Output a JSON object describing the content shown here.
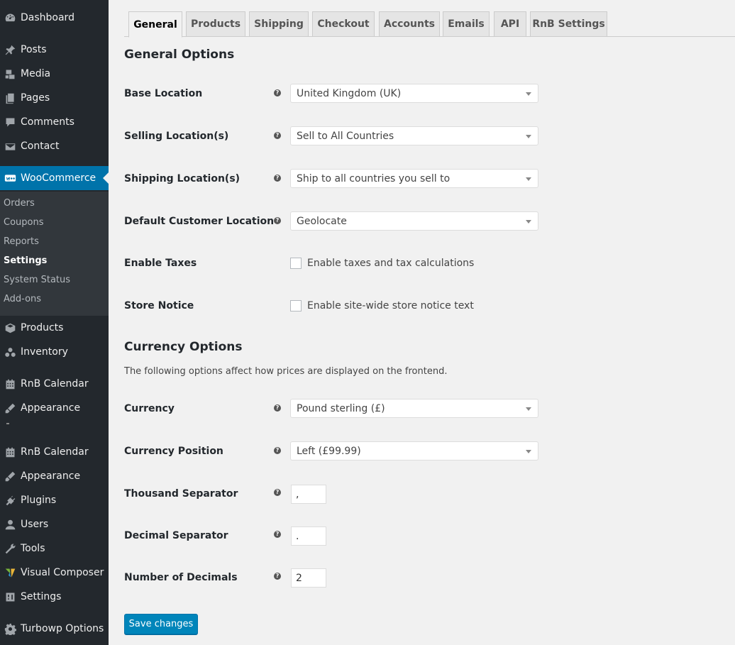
{
  "sidebar": {
    "menu": [
      {
        "label": "Dashboard",
        "icon": "dashboard-icon"
      },
      {
        "label": "Posts",
        "icon": "pin-icon"
      },
      {
        "label": "Media",
        "icon": "media-icon"
      },
      {
        "label": "Pages",
        "icon": "pages-icon"
      },
      {
        "label": "Comments",
        "icon": "comment-icon"
      },
      {
        "label": "Contact",
        "icon": "mail-icon"
      },
      {
        "label": "WooCommerce",
        "icon": "woo-icon"
      },
      {
        "label": "Products",
        "icon": "box-icon"
      },
      {
        "label": "Inventory",
        "icon": "inventory-icon"
      },
      {
        "label": "RnB Calendar",
        "icon": "calendar-icon"
      },
      {
        "label": "Appearance",
        "icon": "brush-icon"
      },
      {
        "label": "RnB Calendar",
        "icon": "calendar-icon"
      },
      {
        "label": "Appearance",
        "icon": "brush-icon"
      },
      {
        "label": "Plugins",
        "icon": "plug-icon"
      },
      {
        "label": "Users",
        "icon": "user-icon"
      },
      {
        "label": "Tools",
        "icon": "wrench-icon"
      },
      {
        "label": "Visual Composer",
        "icon": "vc-icon"
      },
      {
        "label": "Settings",
        "icon": "settings-icon"
      },
      {
        "label": "Turbowp Options",
        "icon": "gear-icon"
      }
    ],
    "submenu": [
      "Orders",
      "Coupons",
      "Reports",
      "Settings",
      "System Status",
      "Add-ons"
    ],
    "submenu_current": "Settings"
  },
  "tabs": [
    "General",
    "Products",
    "Shipping",
    "Checkout",
    "Accounts",
    "Emails",
    "API",
    "RnB Settings"
  ],
  "active_tab": "General",
  "general": {
    "title": "General Options",
    "base_location": {
      "label": "Base Location",
      "value": "United Kingdom (UK)"
    },
    "selling_locations": {
      "label": "Selling Location(s)",
      "value": "Sell to All Countries"
    },
    "shipping_locations": {
      "label": "Shipping Location(s)",
      "value": "Ship to all countries you sell to"
    },
    "default_customer_location": {
      "label": "Default Customer Location",
      "value": "Geolocate"
    },
    "enable_taxes": {
      "label": "Enable Taxes",
      "checkbox_label": "Enable taxes and tax calculations",
      "checked": false
    },
    "store_notice": {
      "label": "Store Notice",
      "checkbox_label": "Enable site-wide store notice text",
      "checked": false
    }
  },
  "currency": {
    "title": "Currency Options",
    "description": "The following options affect how prices are displayed on the frontend.",
    "currency": {
      "label": "Currency",
      "value": "Pound sterling (£)"
    },
    "currency_position": {
      "label": "Currency Position",
      "value": "Left (£99.99)"
    },
    "thousand_separator": {
      "label": "Thousand Separator",
      "value": ","
    },
    "decimal_separator": {
      "label": "Decimal Separator",
      "value": "."
    },
    "number_of_decimals": {
      "label": "Number of Decimals",
      "value": "2"
    }
  },
  "help_icon_glyph": "?",
  "save_label": "Save changes",
  "colors": {
    "sidebar_bg": "#23282d",
    "submenu_bg": "#32373c",
    "accent": "#0073aa",
    "button": "#0085ba",
    "page_bg": "#f1f1f1"
  }
}
